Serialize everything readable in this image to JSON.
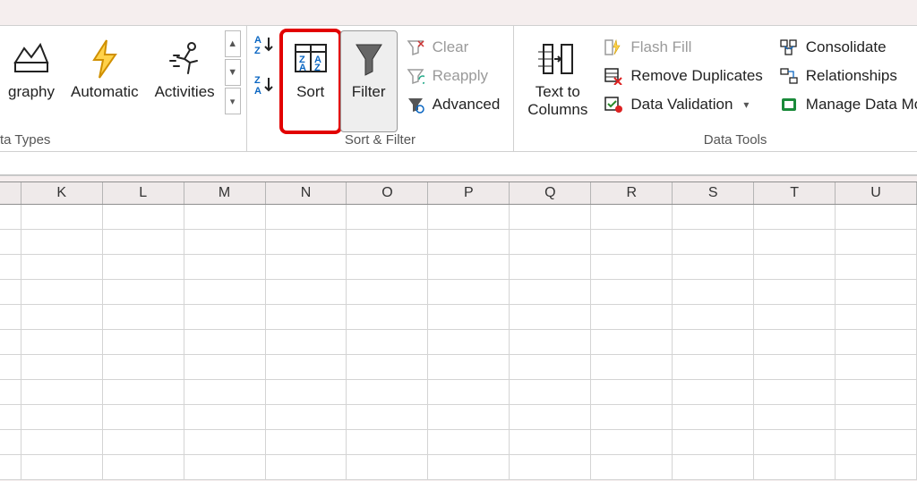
{
  "ribbon": {
    "dataTypes": {
      "geography": "graphy",
      "automatic": "Automatic",
      "activities": "Activities",
      "groupLabel": "ta Types"
    },
    "sortFilter": {
      "sort": "Sort",
      "filter": "Filter",
      "clear": "Clear",
      "reapply": "Reapply",
      "advanced": "Advanced",
      "groupLabel": "Sort & Filter"
    },
    "dataTools": {
      "textToColumns": "Text to\nColumns",
      "flashFill": "Flash Fill",
      "removeDuplicates": "Remove Duplicates",
      "dataValidation": "Data Validation",
      "consolidate": "Consolidate",
      "relationships": "Relationships",
      "manageDataModel": "Manage Data Model",
      "groupLabel": "Data Tools"
    }
  },
  "columns": [
    "",
    "K",
    "L",
    "M",
    "N",
    "O",
    "P",
    "Q",
    "R",
    "S",
    "T",
    "U"
  ]
}
